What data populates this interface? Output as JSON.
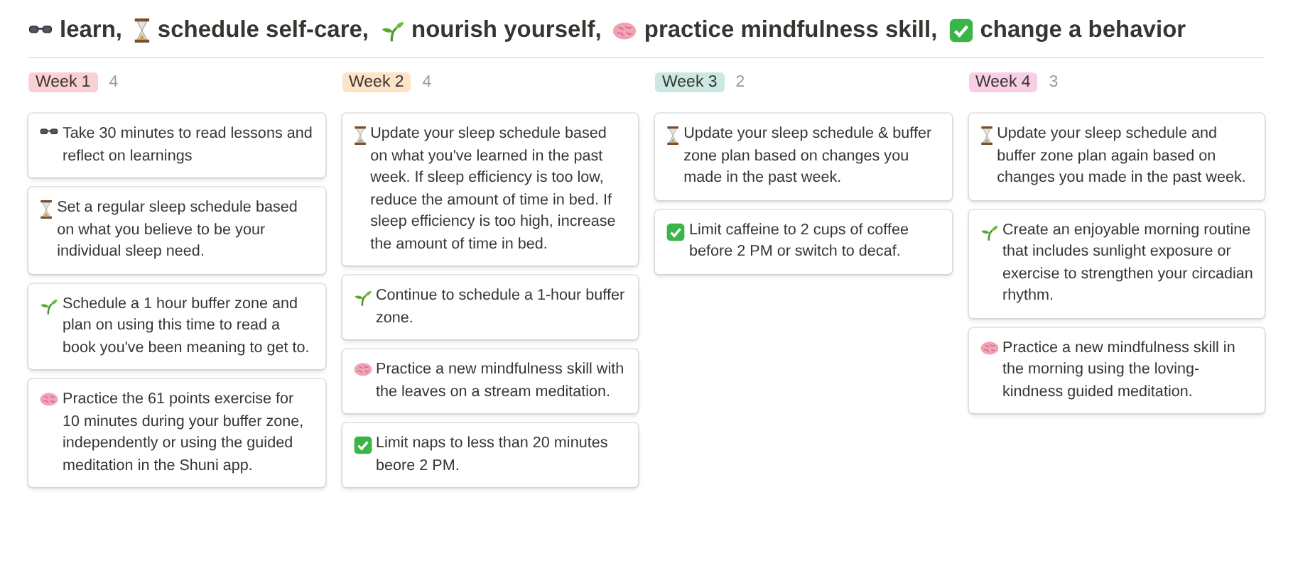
{
  "heading": [
    {
      "kind": "glasses",
      "text": "learn,"
    },
    {
      "kind": "hourglass",
      "text": "schedule self-care,"
    },
    {
      "kind": "sprout",
      "text": "nourish yourself,"
    },
    {
      "kind": "brain",
      "text": "practice mindfulness skill,"
    },
    {
      "kind": "check",
      "text": "change a behavior"
    }
  ],
  "columns": [
    {
      "label": "Week 1",
      "color": "#fbd0d4",
      "count": "4",
      "cards": [
        {
          "kind": "glasses",
          "text": "Take 30 minutes to read lessons and reflect on learnings"
        },
        {
          "kind": "hourglass",
          "text": "Set a regular sleep schedule based on what you believe to be your individual sleep need."
        },
        {
          "kind": "sprout",
          "text": "Schedule a 1 hour buffer zone and plan on using this time to read a book you've been meaning to get to."
        },
        {
          "kind": "brain",
          "text": "Practice the 61 points exercise for 10 minutes during your buffer zone, independently or using the guided meditation in the Shuni app."
        }
      ]
    },
    {
      "label": "Week 2",
      "color": "#fde3c8",
      "count": "4",
      "cards": [
        {
          "kind": "hourglass",
          "text": "Update your sleep schedule based on what you've learned in the past week. If sleep efficiency is too low, reduce the amount of time in bed. If sleep efficiency is too high, increase the amount of time in bed."
        },
        {
          "kind": "sprout",
          "text": "Continue to schedule a 1-hour buffer zone."
        },
        {
          "kind": "brain",
          "text": "Practice a new mindfulness skill with the leaves on a stream meditation."
        },
        {
          "kind": "check",
          "text": "Limit naps to less than 20 minutes beore 2 PM."
        }
      ]
    },
    {
      "label": "Week 3",
      "color": "#cce8e2",
      "count": "2",
      "cards": [
        {
          "kind": "hourglass",
          "text": "Update your sleep schedule & buffer zone plan based on changes you made in the past week."
        },
        {
          "kind": "check",
          "text": "Limit caffeine to 2 cups of coffee before 2 PM or switch to decaf."
        }
      ]
    },
    {
      "label": "Week 4",
      "color": "#f9cfe5",
      "count": "3",
      "cards": [
        {
          "kind": "hourglass",
          "text": "Update your sleep schedule and buffer zone plan again based on changes you made in the past week."
        },
        {
          "kind": "sprout",
          "text": "Create an enjoyable morning routine that includes sunlight exposure or exercise to strengthen your circadian rhythm."
        },
        {
          "kind": "brain",
          "text": "Practice a new mindfulness skill in the morning using the loving-kindness guided meditation."
        }
      ]
    }
  ]
}
